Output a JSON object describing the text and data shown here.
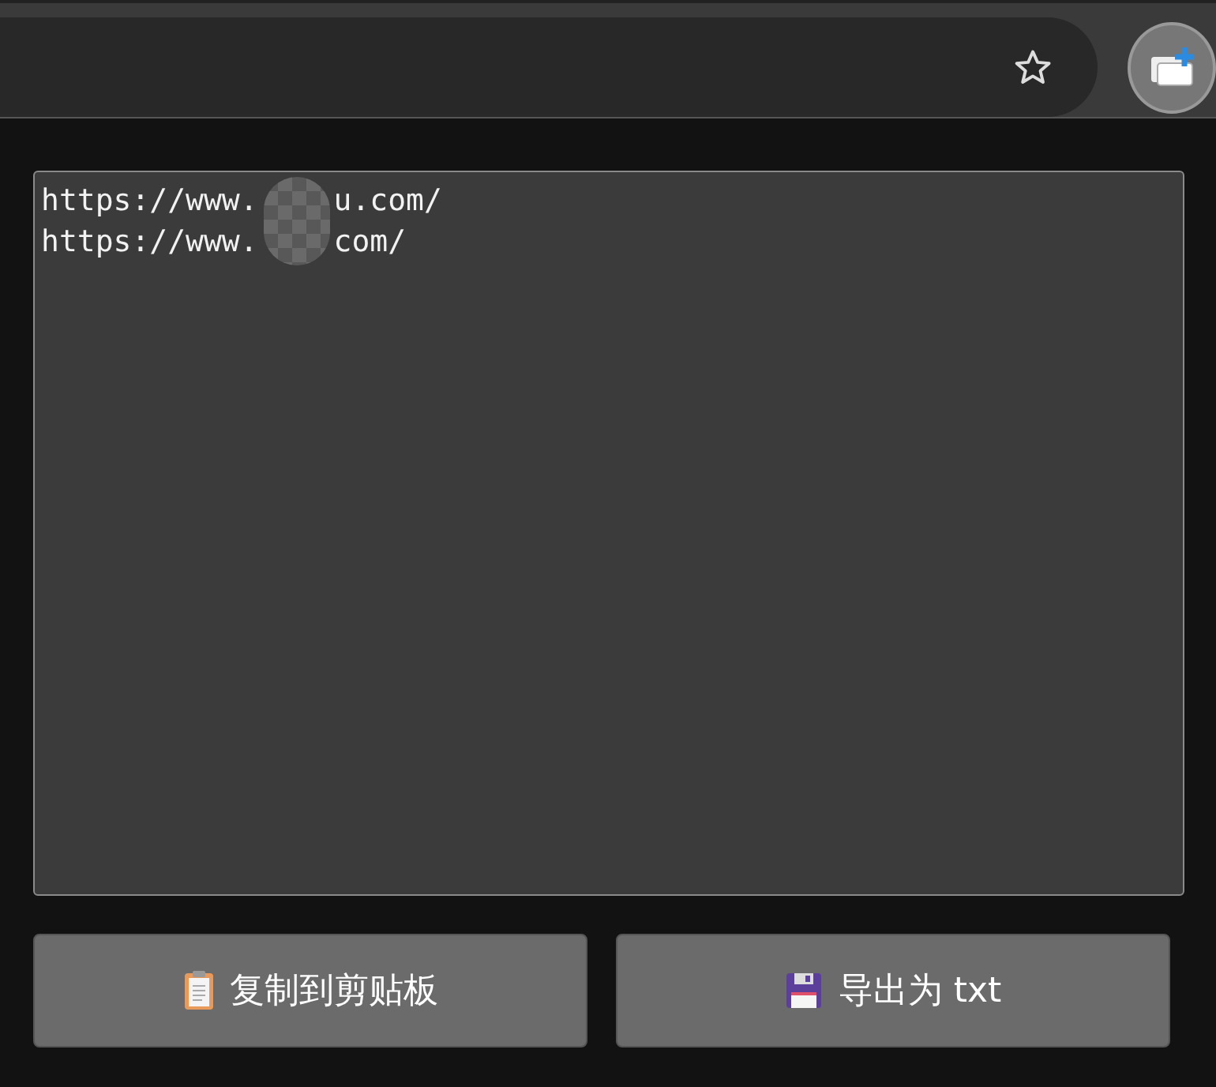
{
  "textarea": {
    "lines": [
      {
        "before": "https://www.",
        "after": "u.com/"
      },
      {
        "before": "https://www.",
        "after": "com/"
      }
    ]
  },
  "buttons": [
    {
      "label": "复制到剪贴板",
      "kind": "copy"
    },
    {
      "label": "导出为 txt",
      "kind": "export"
    }
  ]
}
